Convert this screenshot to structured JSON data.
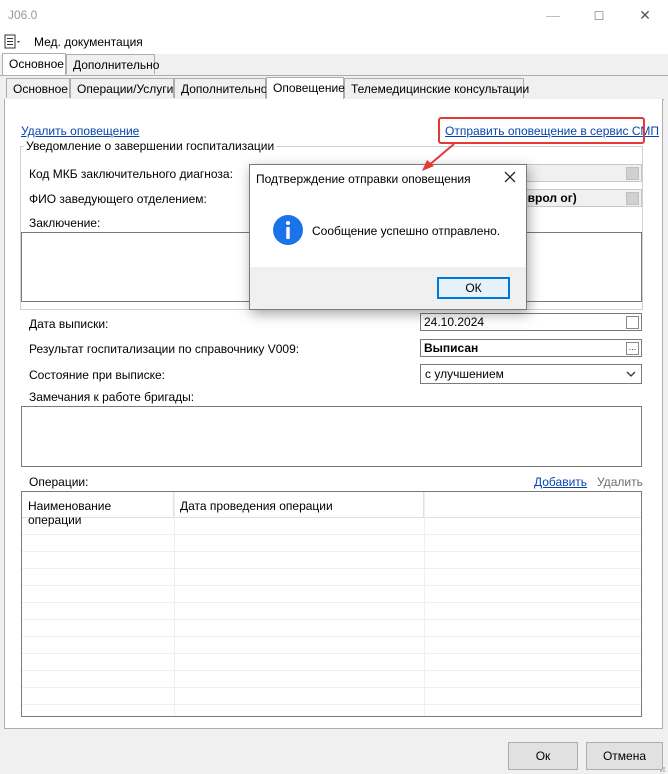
{
  "window": {
    "title": "J06.0",
    "minimize_icon": "minimize-icon",
    "maximize_icon": "maximize-icon",
    "close_icon": "close-icon"
  },
  "menu": {
    "icon": "document-icon",
    "label": "Мед. документация"
  },
  "outer_tabs": [
    {
      "label": "Основное",
      "active": true
    },
    {
      "label": "Дополнительно",
      "active": false
    }
  ],
  "inner_tabs": [
    {
      "label": "Основное",
      "active": false
    },
    {
      "label": "Операции/Услуги",
      "active": false
    },
    {
      "label": "Дополнительно",
      "active": false
    },
    {
      "label": "Оповещение",
      "active": true
    },
    {
      "label": "Телемедицинские консультации",
      "active": false
    }
  ],
  "notification": {
    "delete_link": "Удалить оповещение",
    "send_link": "Отправить оповещение в сервис СМП",
    "group_title": "Уведомление о завершении госпитализации",
    "mkb_label": "Код МКБ заключительного диагноза:",
    "mkb_value": "",
    "head_label": "ФИО заведующего отделением:",
    "head_value": "еврол ог)",
    "conclusion_label": "Заключение:",
    "conclusion_value": ""
  },
  "discharge": {
    "date_label": "Дата выписки:",
    "date_value": "24.10.2024",
    "result_label": "Результат госпитализации по справочнику V009:",
    "result_value": "Выписан",
    "state_label": "Состояние при выписке:",
    "state_value": "с улучшением",
    "remarks_label": "Замечания к работе бригады:",
    "remarks_value": ""
  },
  "operations": {
    "label": "Операции:",
    "add_link": "Добавить",
    "delete_link": "Удалить",
    "columns": [
      "Наименование операции",
      "Дата проведения операции",
      ""
    ]
  },
  "dialog": {
    "title": "Подтверждение отправки оповещения",
    "message": "Сообщение успешно отправлено.",
    "ok_label": "ОК",
    "icon": "info-icon"
  },
  "footer": {
    "ok_label": "Ок",
    "cancel_label": "Отмена"
  },
  "colors": {
    "highlight": "#e53935",
    "link": "#0645ad",
    "info": "#1a73e8",
    "default_button": "#0078d7"
  }
}
